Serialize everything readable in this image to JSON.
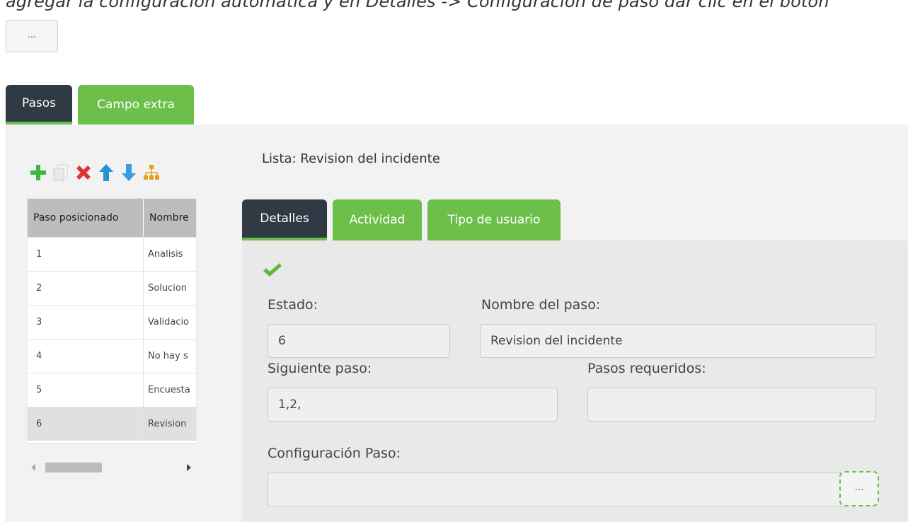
{
  "instruction": {
    "text": "agregar la configuración automática y en Detalles -> Configuración de paso dar clic en el botón"
  },
  "top_button": {
    "label": "..."
  },
  "outer_tabs": [
    {
      "label": "Pasos",
      "active": true
    },
    {
      "label": "Campo extra",
      "active": false
    }
  ],
  "toolbar": {
    "icons": [
      "add-icon",
      "copy-icon",
      "delete-icon",
      "move-up-icon",
      "move-down-icon",
      "hierarchy-icon"
    ],
    "colors": {
      "add": "#3cb83c",
      "delete": "#e03030",
      "up": "#2b8ed8",
      "down": "#3d9be0",
      "hierarchy": "#e3a019"
    }
  },
  "grid": {
    "columns": [
      "Paso posicionado",
      "Nombre"
    ],
    "rows": [
      {
        "pos": "1",
        "name": "Analisis"
      },
      {
        "pos": "2",
        "name": "Solucion"
      },
      {
        "pos": "3",
        "name": "Validacio"
      },
      {
        "pos": "4",
        "name": "No hay s"
      },
      {
        "pos": "5",
        "name": "Encuesta"
      },
      {
        "pos": "6",
        "name": "Revision"
      }
    ],
    "selected_index": 5
  },
  "lista": {
    "label": "Lista: Revision del incidente"
  },
  "inner_tabs": [
    {
      "label": "Detalles",
      "active": true
    },
    {
      "label": "Actividad",
      "active": false
    },
    {
      "label": "Tipo de usuario",
      "active": false
    }
  ],
  "details": {
    "estado": {
      "label": "Estado:",
      "value": "6"
    },
    "nombre": {
      "label": "Nombre del paso:",
      "value": "Revision del incidente"
    },
    "siguiente": {
      "label": "Siguiente paso:",
      "value": "1,2,"
    },
    "requeridos": {
      "label": "Pasos requeridos:",
      "value": ""
    },
    "config": {
      "label": "Configuración Paso:",
      "value": "",
      "button": "..."
    }
  },
  "colors": {
    "accent_green": "#6cc04a",
    "dark_tab": "#2f3a44"
  }
}
